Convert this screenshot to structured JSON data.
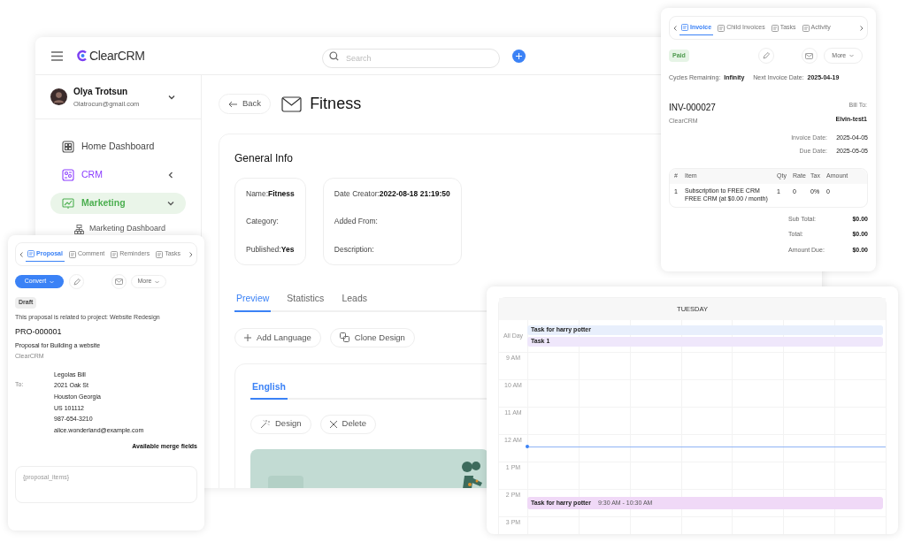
{
  "app": {
    "logo": "ClearCRM",
    "search_placeholder": "Search",
    "user": {
      "name": "Olya Trotsun",
      "email": "Olatrocun@gmail.com"
    },
    "nav": [
      {
        "label": "Home Dashboard",
        "kind": "link",
        "color": "#555555",
        "selected": false
      },
      {
        "label": "CRM",
        "kind": "group",
        "color": "#8b3dff",
        "selected": false,
        "expanded": false
      },
      {
        "label": "Marketing",
        "kind": "group",
        "color": "#4caf50",
        "selected": true,
        "expanded": true,
        "children": [
          {
            "label": "Marketing Dashboard"
          }
        ]
      }
    ],
    "back": "Back",
    "title": "Fitness",
    "general_info": {
      "heading": "General Info",
      "groups": [
        [
          {
            "label": "Name:",
            "value": "Fitness"
          },
          {
            "label": "Category:"
          },
          {
            "label": "Published:",
            "value": "Yes"
          }
        ],
        [
          {
            "label": "Date Creator:",
            "value": "2022-08-18 21:19:50"
          },
          {
            "label": "Added From:"
          },
          {
            "label": "Description:"
          }
        ]
      ]
    },
    "tabs": [
      {
        "label": "Preview",
        "selected": true
      },
      {
        "label": "Statistics",
        "selected": false
      },
      {
        "label": "Leads",
        "selected": false
      }
    ],
    "actions": [
      {
        "label": "Add Language",
        "kind": "add"
      },
      {
        "label": "Clone Design",
        "kind": "clone"
      }
    ],
    "language_tabs": [
      {
        "label": "English",
        "selected": true
      }
    ],
    "language_actions": [
      {
        "label": "Design",
        "kind": "design"
      },
      {
        "label": "Delete",
        "kind": "delete"
      }
    ]
  },
  "invoice": {
    "tabs": [
      {
        "label": "Invoice",
        "selected": true
      },
      {
        "label": "Child Invoices",
        "selected": false
      },
      {
        "label": "Tasks",
        "selected": false
      },
      {
        "label": "Activity",
        "selected": false
      }
    ],
    "status": "Paid",
    "more": "More",
    "meta": [
      {
        "label": "Cycles Remaining:",
        "value": "Infinity"
      },
      {
        "label": "Next Invoice Date:",
        "value": "2025-04-19"
      }
    ],
    "number": "INV-000027",
    "company": "ClearCRM",
    "bill_to_label": "Bill To:",
    "bill_to": "Elvin-test1",
    "dates": [
      {
        "label": "Invoice Date:",
        "value": "2025-04-05"
      },
      {
        "label": "Due Date:",
        "value": "2025-05-05"
      }
    ],
    "columns": [
      "#",
      "Item",
      "Qty",
      "Rate",
      "Tax",
      "Amount"
    ],
    "rows": [
      {
        "number": "1",
        "item": "Subscription to FREE CRM",
        "description": "FREE CRM (at $0.00 / month)",
        "qty": "1",
        "rate": "0",
        "tax": "0%",
        "amount": "0"
      }
    ],
    "totals": [
      {
        "label": "Sub Total:",
        "value": "$0.00"
      },
      {
        "label": "Total:",
        "value": "$0.00"
      },
      {
        "label": "Amount Due:",
        "value": "$0.00"
      }
    ]
  },
  "proposal": {
    "tabs": [
      {
        "label": "Proposal",
        "selected": true
      },
      {
        "label": "Comment",
        "selected": false
      },
      {
        "label": "Reminders",
        "selected": false
      },
      {
        "label": "Tasks",
        "selected": false
      }
    ],
    "convert": "Convert",
    "more": "More",
    "status": "Draft",
    "related": "This proposal is related to project: Website Redesign",
    "number": "PRO-000001",
    "subject": "Proposal for Building a website",
    "company": "ClearCRM",
    "to_label": "To:",
    "address": [
      "Legolas Bill",
      "2021 Oak St",
      "Houston Georgia",
      "US 101112",
      "987-654-3210",
      "alice.wonderland@example.com"
    ],
    "merge_fields": "Available merge fields",
    "items_placeholder": "{proposal_items}"
  },
  "calendar": {
    "day": "TUESDAY",
    "all_day_label": "All Day",
    "all_day_events": [
      {
        "title": "Task for harry potter",
        "color": "#e8effc"
      },
      {
        "title": "Task 1",
        "color": "#efe7fb"
      }
    ],
    "hours": [
      {
        "label": "9 AM",
        "current": false
      },
      {
        "label": "10 AM",
        "current": false
      },
      {
        "label": "11 AM",
        "current": false
      },
      {
        "label": "12 AM",
        "current": true
      },
      {
        "label": "1 PM",
        "current": false
      },
      {
        "label": "2 PM",
        "current": false,
        "events": [
          {
            "title": "Task for harry potter",
            "time": "9:30 AM - 10:30 AM",
            "color": "#f0d9f7"
          }
        ]
      },
      {
        "label": "3 PM",
        "current": false
      }
    ]
  }
}
